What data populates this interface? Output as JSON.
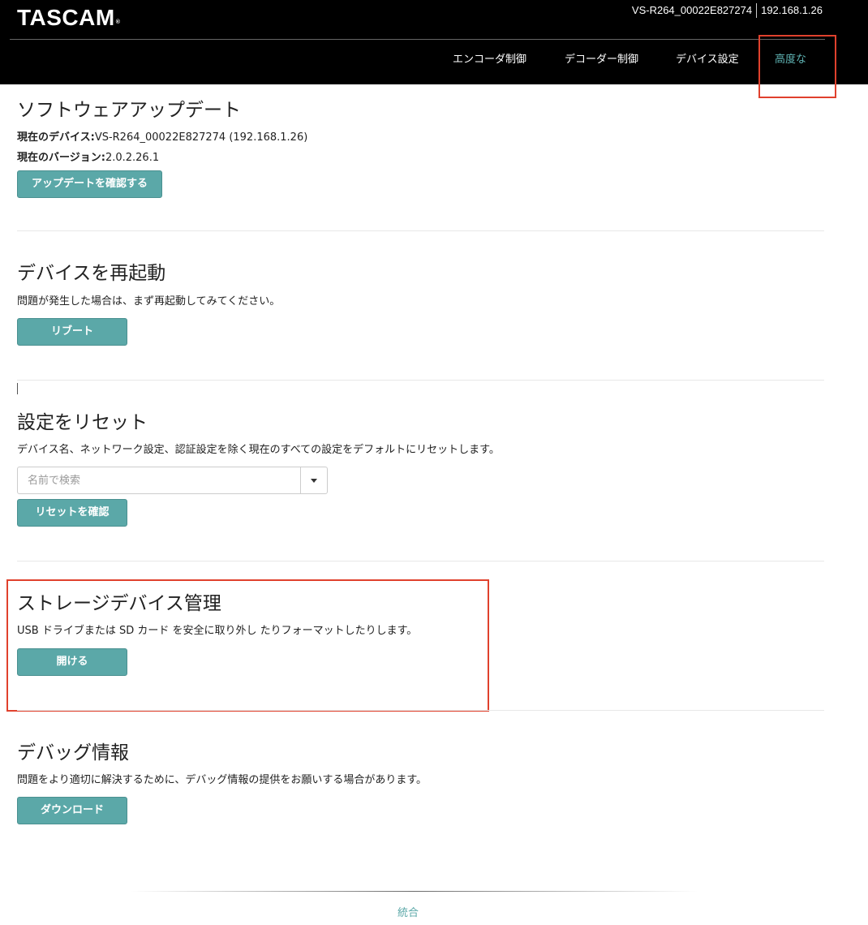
{
  "header": {
    "brand": "TASCAM",
    "brand_mark": "®",
    "device_name": "VS-R264_00022E827274",
    "device_ip": "192.168.1.26",
    "nav": [
      {
        "label": "エンコーダ制御",
        "active": false
      },
      {
        "label": "デコーダー制御",
        "active": false
      },
      {
        "label": "デバイス設定",
        "active": false
      },
      {
        "label": "高度な",
        "active": true
      }
    ]
  },
  "software_update": {
    "title": "ソフトウェアアップデート",
    "current_device_label": "現在のデバイス:",
    "current_device_value": "VS-R264_00022E827274 (192.168.1.26)",
    "current_version_label": "現在のバージョン:",
    "current_version_value": "2.0.2.26.1",
    "button": "アップデートを確認する"
  },
  "restart": {
    "title": "デバイスを再起動",
    "description": "問題が発生した場合は、まず再起動してみてください。",
    "button": "リブート"
  },
  "reset": {
    "title": "設定をリセット",
    "description": "デバイス名、ネットワーク設定、認証設定を除く現在のすべての設定をデフォルトにリセットします。",
    "search_placeholder": "名前で検索",
    "button": "リセットを確認"
  },
  "storage": {
    "title": "ストレージデバイス管理",
    "description": "USB ドライブまたは SD カード を安全に取り外し たりフォーマットしたりします。",
    "button": "開ける"
  },
  "debug": {
    "title": "デバッグ情報",
    "description": "問題をより適切に解決するために、デバッグ情報の提供をお願いする場合があります。",
    "button": "ダウンロード"
  },
  "footer": {
    "link": "統合"
  },
  "colors": {
    "accent": "#5ba8a8",
    "header_bg": "#000000",
    "highlight_box": "#e0412d"
  }
}
